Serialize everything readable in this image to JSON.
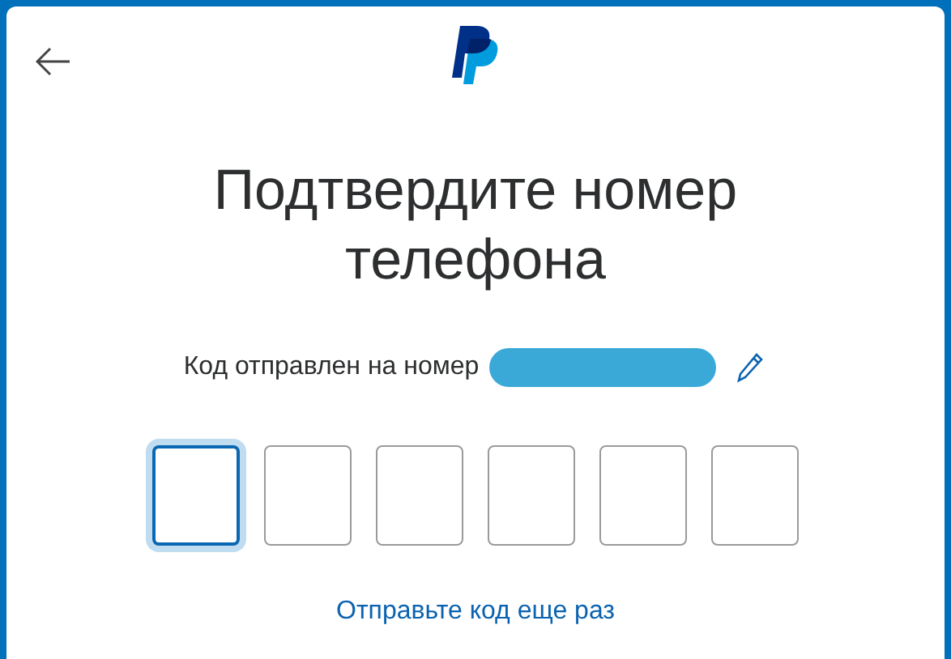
{
  "title": "Подтвердите номер телефона",
  "sent_to": {
    "label": "Код отправлен на номер",
    "number_hidden": true
  },
  "code_boxes": [
    {
      "focused": true
    },
    {
      "focused": false
    },
    {
      "focused": false
    },
    {
      "focused": false
    },
    {
      "focused": false
    },
    {
      "focused": false
    }
  ],
  "resend_link": "Отправьте код еще раз"
}
